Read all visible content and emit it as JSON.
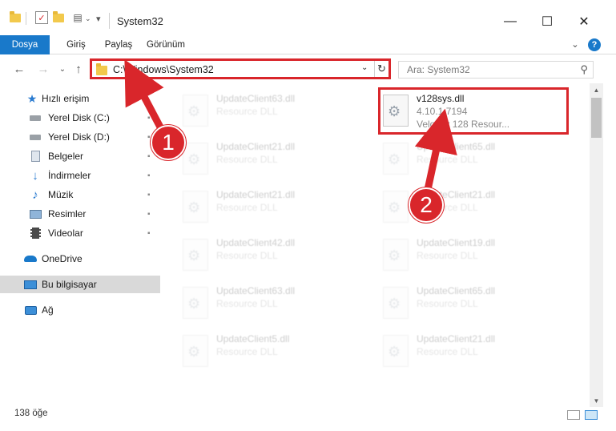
{
  "window": {
    "title": "System32",
    "minimize": "—",
    "maximize": "☐",
    "close": "✕"
  },
  "ribbon": {
    "tabs": [
      "Dosya",
      "Giriş",
      "Paylaş",
      "Görünüm"
    ],
    "expand": "⌄",
    "help": "?"
  },
  "nav": {
    "back": "←",
    "forward": "→",
    "recent": "⌄",
    "up": "↑",
    "address": "C:\\Windows\\System32",
    "address_dropdown": "⌄",
    "refresh": "↻",
    "search_placeholder": "Ara: System32",
    "search_icon": "⚲"
  },
  "sidebar": {
    "items": [
      {
        "label": "Hızlı erişim",
        "icon": "star-icon",
        "pinned": false
      },
      {
        "label": "Yerel Disk (C:)",
        "icon": "drive-icon",
        "pinned": true
      },
      {
        "label": "Yerel Disk (D:)",
        "icon": "drive-icon",
        "pinned": true
      },
      {
        "label": "Belgeler",
        "icon": "documents-icon",
        "pinned": true
      },
      {
        "label": "İndirmeler",
        "icon": "download-icon",
        "pinned": true
      },
      {
        "label": "Müzik",
        "icon": "music-icon",
        "pinned": true
      },
      {
        "label": "Resimler",
        "icon": "pictures-icon",
        "pinned": true
      },
      {
        "label": "Videolar",
        "icon": "video-icon",
        "pinned": true
      },
      {
        "label": "OneDrive",
        "icon": "cloud-icon",
        "pinned": false
      },
      {
        "label": "Bu bilgisayar",
        "icon": "computer-icon",
        "pinned": false,
        "selected": true
      },
      {
        "label": "Ağ",
        "icon": "network-icon",
        "pinned": false
      }
    ],
    "pin_glyph": "📌"
  },
  "files": {
    "highlighted": {
      "name": "v128sys.dll",
      "version": "4.10.1.7194",
      "description": "Velocity 128 Resour..."
    },
    "left_column": [
      {
        "name": "UpdateClient63.dll",
        "type": "Resource DLL"
      },
      {
        "name": "UpdateClient21.dll",
        "type": "Resource DLL"
      },
      {
        "name": "UpdateClient21.dll",
        "type": "Resource DLL"
      },
      {
        "name": "UpdateClient42.dll",
        "type": "Resource DLL"
      },
      {
        "name": "UpdateClient63.dll",
        "type": "Resource DLL"
      },
      {
        "name": "UpdateClient5.dll",
        "type": "Resource DLL"
      }
    ],
    "right_column": [
      {
        "name": "UpdateClient65.dll",
        "type": "Resource DLL"
      },
      {
        "name": "UpdateClient21.dll",
        "type": "Resource DLL"
      },
      {
        "name": "UpdateClient19.dll",
        "type": "Resource DLL"
      },
      {
        "name": "UpdateClient65.dll",
        "type": "Resource DLL"
      },
      {
        "name": "UpdateClient21.dll",
        "type": "Resource DLL"
      }
    ]
  },
  "status": {
    "count": "138 öğe"
  },
  "annotations": {
    "badge1": "1",
    "badge2": "2",
    "color": "#d9262b"
  }
}
